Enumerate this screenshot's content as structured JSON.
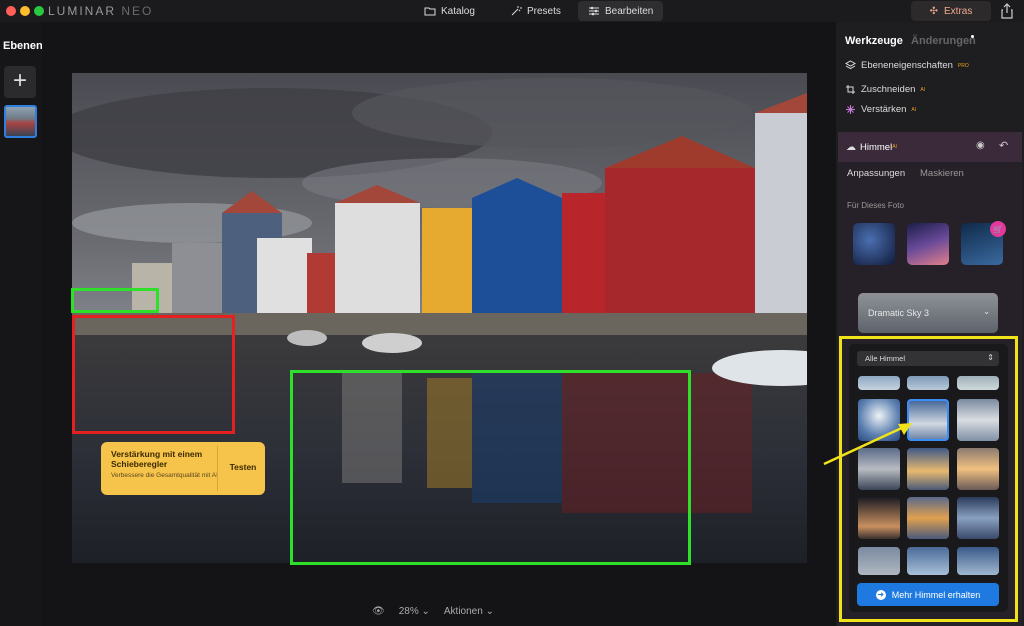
{
  "app": {
    "logo": "LUMINAR",
    "logo_suffix": "NEO"
  },
  "topbar": {
    "tabs": [
      {
        "label": "Katalog",
        "icon": "folder-icon"
      },
      {
        "label": "Presets",
        "icon": "magic-wand-icon"
      },
      {
        "label": "Bearbeiten",
        "icon": "sliders-icon",
        "active": true
      }
    ],
    "extras_label": "Extras"
  },
  "layers": {
    "title": "Ebenen"
  },
  "statusbar": {
    "zoom": "28%",
    "actions": "Aktionen"
  },
  "tooltip": {
    "title": "Verstärkung mit einem Schieberegler",
    "description": "Verbessere die Gesamtqualität mit AI",
    "button": "Testen"
  },
  "sidebar": {
    "tab_tools": "Werkzeuge",
    "tab_changes": "Änderungen",
    "tools": [
      {
        "label": "Ebeneneigenschaften",
        "badge": "PRO"
      },
      {
        "label": "Zuschneiden",
        "badge": "AI"
      },
      {
        "label": "Verstärken",
        "badge": "AI"
      }
    ],
    "sky": {
      "title": "Himmel",
      "badge": "AI",
      "subtabs": [
        "Anpassungen",
        "Maskieren"
      ],
      "for_photo": "Für Dieses Foto",
      "selected_sky": "Dramatic Sky 3",
      "filter": "Alle Himmel",
      "more_button": "Mehr Himmel erhalten"
    }
  },
  "colors": {
    "accent_blue": "#1e7ae0",
    "highlight_yellow": "#f2e21a",
    "highlight_green": "#2fe02a",
    "highlight_red": "#e42020",
    "tooltip_yellow": "#f6c34b"
  }
}
